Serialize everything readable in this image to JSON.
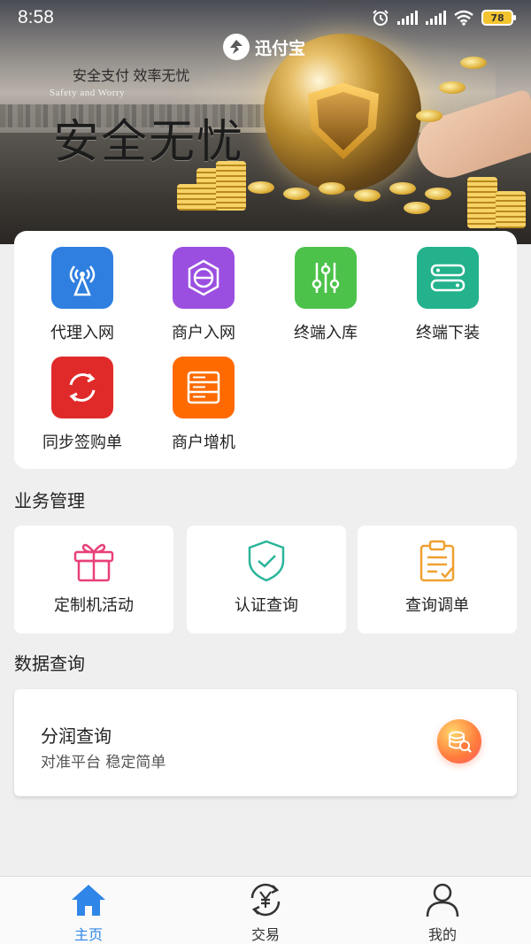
{
  "status_bar": {
    "time": "8:58",
    "battery": "78"
  },
  "banner": {
    "brand_name": "迅付宝",
    "slogan": "安全支付 效率无忧",
    "slogan_en": "Safety and Worry",
    "big_title": "安全无忧"
  },
  "quick_actions": [
    {
      "label": "代理入网",
      "icon": "signal-tower-icon",
      "color": "#2f7fe0"
    },
    {
      "label": "商户入网",
      "icon": "merchant-e-icon",
      "color": "#9b4fe0"
    },
    {
      "label": "终端入库",
      "icon": "sliders-icon",
      "color": "#4cc24a"
    },
    {
      "label": "终端下装",
      "icon": "server-icon",
      "color": "#23b28c"
    },
    {
      "label": "同步签购单",
      "icon": "sync-icon",
      "color": "#e02a2a"
    },
    {
      "label": "商户增机",
      "icon": "storage-icon",
      "color": "#ff6a00"
    }
  ],
  "business": {
    "title": "业务管理",
    "items": [
      {
        "label": "定制机活动",
        "icon": "gift-icon",
        "color": "#e8407a"
      },
      {
        "label": "认证查询",
        "icon": "shield-check-icon",
        "color": "#2bb59a"
      },
      {
        "label": "查询调单",
        "icon": "clipboard-icon",
        "color": "#f0a030"
      }
    ]
  },
  "data_query": {
    "title": "数据查询",
    "card": {
      "title": "分润查询",
      "subtitle": "对准平台 稳定简单",
      "icon": "database-search-icon"
    }
  },
  "bottom_nav": {
    "items": [
      {
        "label": "主页",
        "icon": "home-icon",
        "active": true
      },
      {
        "label": "交易",
        "icon": "yuan-exchange-icon",
        "active": false
      },
      {
        "label": "我的",
        "icon": "person-icon",
        "active": false
      }
    ]
  },
  "colors": {
    "accent": "#2f86e8",
    "background": "#efefef"
  }
}
